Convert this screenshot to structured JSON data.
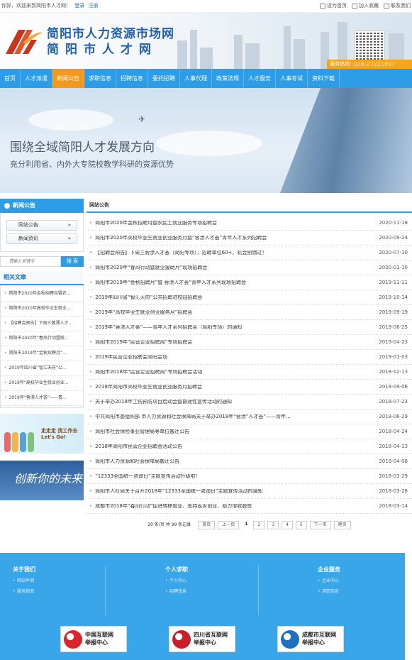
{
  "topbar": {
    "greeting": "你好，欢迎来到简阳市人才网！",
    "login": "登录",
    "register": "注册",
    "set_home": "设为首页",
    "favorite": "加入收藏",
    "contact": "联系我们"
  },
  "header": {
    "title": "简阳市人力资源市场网",
    "subtitle": "简阳市人才网",
    "hotline_label": "服务热线:",
    "hotline_number": "028-27221897"
  },
  "nav": {
    "items": [
      "首页",
      "人才派遣",
      "新闻公告",
      "求职信息",
      "招聘信息",
      "委托招聘",
      "人事代理",
      "政策法规",
      "人才服务",
      "人事考试",
      "资料下载"
    ],
    "active_index": 2
  },
  "hero": {
    "headline": "围绕全域简阳人才发展方向",
    "subline": "充分利用省、内外大专院校教学科研的资源优势"
  },
  "sidebar": {
    "news_title": "新闻公告",
    "buttons": [
      "网站公告",
      "新闻资讯"
    ],
    "search_placeholder": "请输入关键字",
    "search_button": "搜 索",
    "related_title": "相关文章",
    "related": [
      "简阳市2020年金秋招聘月暨农...",
      "简阳市2020年高校毕业生就业...",
      "【招聘会预告】下周三蓉漂人才...",
      "简阳市2020年“春风行动暨就...",
      "简阳市2019年“金秋招聘月”...",
      "2019年四川省“智汇天府”公...",
      "2019年“高校毕业生就业创业...",
      "2019年“蓉漂人才荟”——青..."
    ],
    "ad1_text": "走走走 找工作去 Let's Go!",
    "ad2_text": "创新你的未来"
  },
  "main": {
    "breadcrumb": "网站公告",
    "articles": [
      {
        "title": "简阳市2020年金秋招聘月暨农民工就业服务专场招聘会",
        "date": "2020-11-18"
      },
      {
        "title": "简阳市2020年高校毕业生就业创业服务月暨“蓉漂人才荟”青年人才系列招聘会",
        "date": "2020-09-24"
      },
      {
        "title": "【招聘会预告】下周三蓉漂人才荟（简阳专场），招聘单位60+，机会别错过！",
        "date": "2020-07-10"
      },
      {
        "title": "简阳市2020年“春风行动暨就业援助月”现场招聘会",
        "date": "2020-01-10"
      },
      {
        "title": "简阳市2019年“金秋招聘月”暨 蓉漂人才荟”青年人才系列现场招聘会",
        "date": "2019-11-11"
      },
      {
        "title": "2019年四川省“智汇天府”公共招聘进校园招聘会",
        "date": "2019-10-14"
      },
      {
        "title": "2019年“高校毕业生就业创业服务月”招聘会",
        "date": "2019-09-19"
      },
      {
        "title": "2019年“蓉漂人才荟”——青年人才系列招聘会（简阳专场）的通知",
        "date": "2019-06-25"
      },
      {
        "title": "简阳市2019年“民营企业招聘周”专场招聘会",
        "date": "2019-04-23"
      },
      {
        "title": "2019年民营企业招聘会简阳会场",
        "date": "2019-01-03"
      },
      {
        "title": "简阳市2018年“民营企业招聘周”专场招聘会活动",
        "date": "2018-12-13"
      },
      {
        "title": "2018年简阳市高校毕业生就业创业服务月招聘会",
        "date": "2018-09-06"
      },
      {
        "title": "关于举办2018年工伤预防项目启动会暨普适性宣传活动的通知",
        "date": "2018-07-23"
      },
      {
        "title": "中共简阳市委组织部 市人力资源和社会保障局关于举办2018年“蓉漂”人才荟”——青年...",
        "date": "2018-06-29"
      },
      {
        "title": "简阳市社会保险事业管理局等单位搬迁公告",
        "date": "2018-04-24"
      },
      {
        "title": "2018年简阳市民营企业招聘会活动公告",
        "date": "2018-04-13"
      },
      {
        "title": "简阳市人力资源和社会保障局搬迁公告",
        "date": "2018-04-08"
      },
      {
        "title": "“12333全国统一咨询日”主题宣传活动升级啦！",
        "date": "2018-03-29"
      },
      {
        "title": "简阳市人社局关于召开2018年“12333全国统一咨询日”主题宣传活动的通知",
        "date": "2018-03-28"
      },
      {
        "title": "成都市2018年“春风行动”促进转移就业、支持返乡创业、助力增收脱贫",
        "date": "2018-03-14"
      }
    ]
  },
  "pager": {
    "info": "20 条/页 共 99 条记录",
    "first": "首页",
    "prev": "上一页",
    "pages": [
      "1",
      "2",
      "3",
      "4",
      "5"
    ],
    "current": "1",
    "next": "下一页",
    "last": "尾页"
  },
  "footer": {
    "cols": [
      {
        "title": "关于我们",
        "links": [
          "网站声明",
          "服务指南"
        ]
      },
      {
        "title": "个人求职",
        "links": [
          "个人中心",
          "招聘信息"
        ]
      },
      {
        "title": "企业服务",
        "links": [
          "企业中心",
          "求职信息"
        ]
      }
    ],
    "badges": [
      {
        "line1": "中国互联网",
        "line2": "举报中心",
        "color": "#d8262a"
      },
      {
        "line1": "四川省互联网",
        "line2": "举报中心",
        "color": "#c81f28"
      },
      {
        "line1": "成都市互联网",
        "line2": "举报中心",
        "color": "#1f6fc0"
      }
    ]
  }
}
